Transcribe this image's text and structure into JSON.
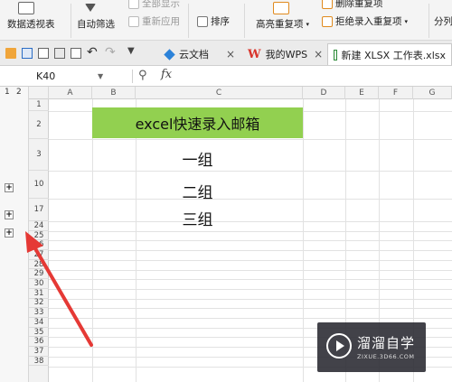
{
  "ribbon": {
    "pivot_label": "数据透视表",
    "autofilter_label": "自动筛选",
    "show_all_label": "全部显示",
    "reapply_label": "重新应用",
    "sort_label": "排序",
    "highlight_dup_label": "高亮重复项",
    "delete_dup_label": "删除重复项",
    "reject_dup_label": "拒绝录入重复项",
    "split_label": "分列"
  },
  "tabs": [
    {
      "label": "云文档"
    },
    {
      "label": "我的WPS"
    },
    {
      "label": "新建 XLSX 工作表.xlsx"
    }
  ],
  "tab_close": "×",
  "formula_bar": {
    "cell_ref": "K40",
    "fx": "fx",
    "zoom_glyph": "⚲"
  },
  "outline": {
    "levels": [
      "1",
      "2"
    ],
    "expand_symbol": "+"
  },
  "columns": [
    "A",
    "B",
    "C",
    "D",
    "E",
    "F",
    "G"
  ],
  "rows": [
    "1",
    "2",
    "3",
    "10",
    "17",
    "24",
    "25",
    "26",
    "27",
    "28",
    "29",
    "30",
    "31",
    "32",
    "33",
    "34",
    "35",
    "36",
    "37",
    "38"
  ],
  "cells": {
    "title": "excel快速录入邮箱",
    "group1": "一组",
    "group2": "二组",
    "group3": "三组"
  },
  "colors": {
    "title_fill": "#92d050",
    "arrow": "#e53935"
  },
  "watermark": {
    "brand": "溜溜自学",
    "url": "ZIXUE.3D66.COM"
  }
}
